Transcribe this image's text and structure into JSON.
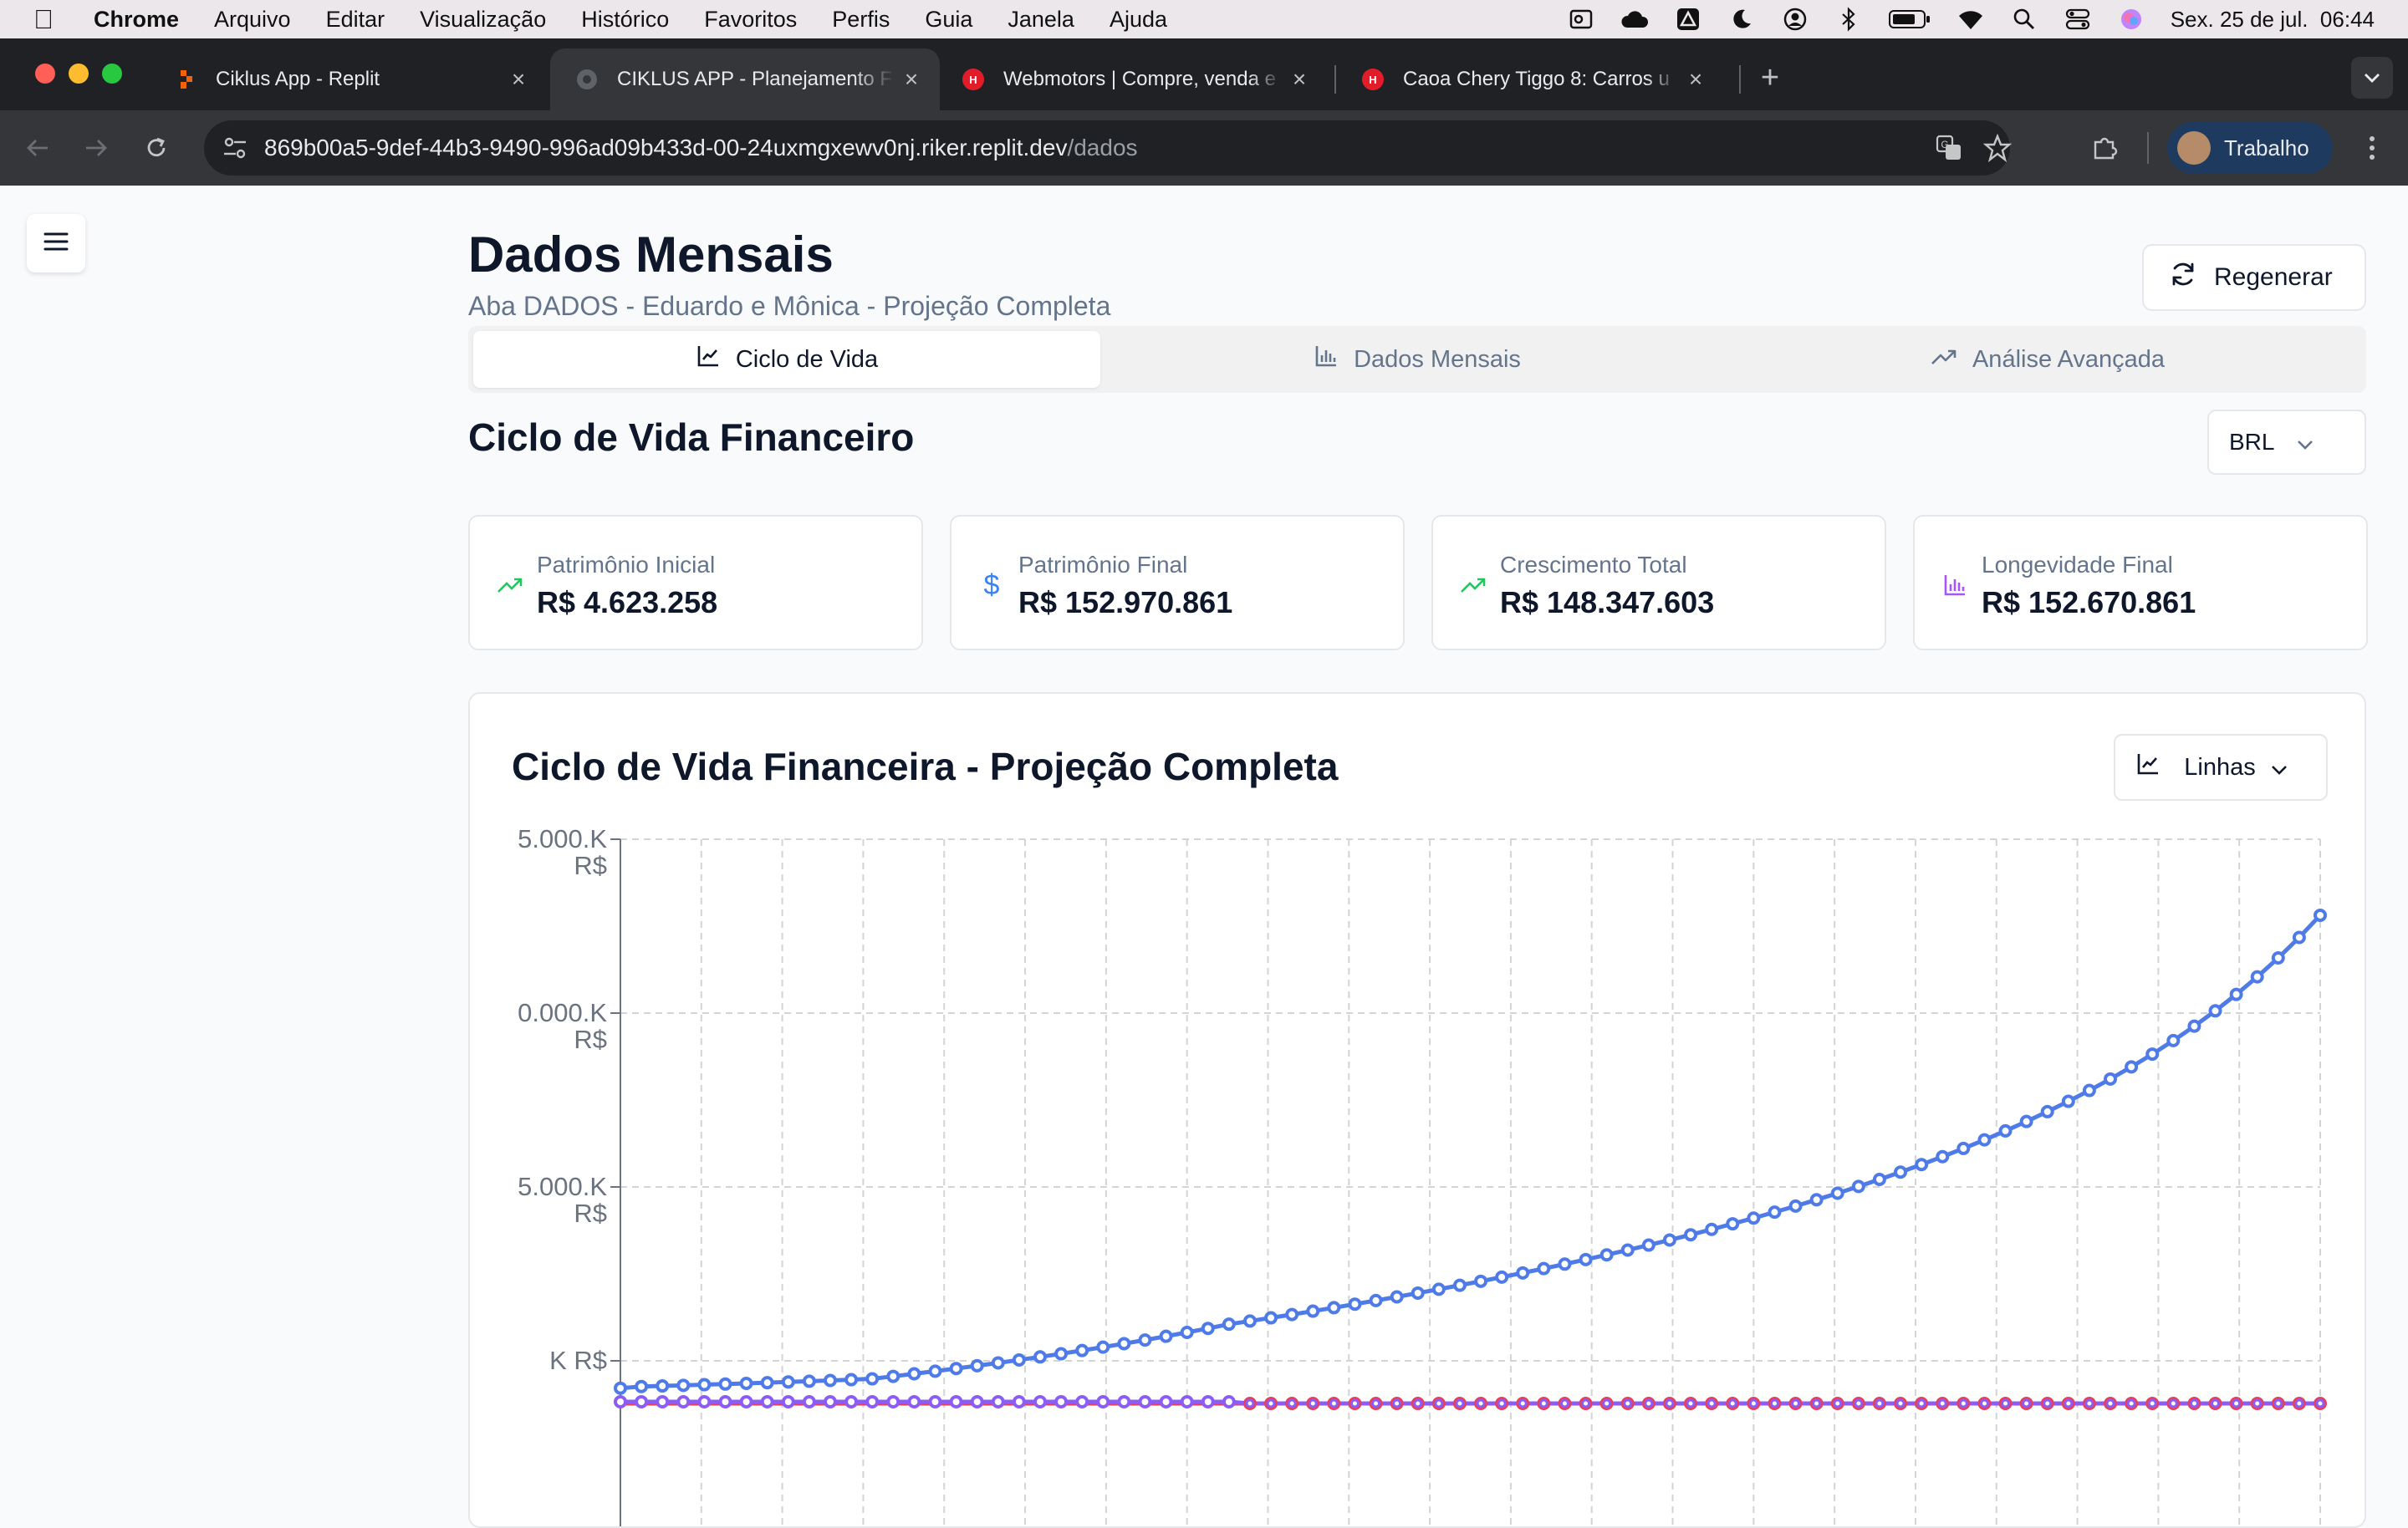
{
  "menubar": {
    "app": "Chrome",
    "items": [
      "Arquivo",
      "Editar",
      "Visualização",
      "Histórico",
      "Favoritos",
      "Perfis",
      "Guia",
      "Janela",
      "Ajuda"
    ],
    "clock": "Sex. 25 de jul.  06:44"
  },
  "browser": {
    "tabs": [
      {
        "title": "Ciklus App - Replit",
        "favicon_color": "#f26207"
      },
      {
        "title": "CIKLUS APP - Planejamento F",
        "favicon_color": "#5f6368"
      },
      {
        "title": "Webmotors | Compre, venda e",
        "favicon_color": "#e11d2a"
      },
      {
        "title": "Caoa Chery Tiggo 8: Carros u",
        "favicon_color": "#e11d2a"
      }
    ],
    "active_tab": 1,
    "url_host": "869b00a5-9def-44b3-9490-996ad09b433d-00-24uxmgxewv0nj.riker.replit.dev",
    "url_path": "/dados",
    "profile": "Trabalho"
  },
  "page": {
    "title": "Dados Mensais",
    "subtitle": "Aba DADOS - Eduardo e Mônica - Projeção Completa",
    "regen_label": "Regenerar",
    "tabs": [
      {
        "label": "Ciclo de Vida",
        "icon": "line-chart-icon"
      },
      {
        "label": "Dados Mensais",
        "icon": "bar-chart-icon"
      },
      {
        "label": "Análise Avançada",
        "icon": "trending-up-icon"
      }
    ],
    "section_title": "Ciclo de Vida Financeiro",
    "currency": "BRL",
    "cards": [
      {
        "label": "Patrimônio Inicial",
        "value": "R$ 4.623.258",
        "icon": "trending-up-icon",
        "color": "#22c55e"
      },
      {
        "label": "Patrimônio Final",
        "value": "R$ 152.970.861",
        "icon": "dollar-icon",
        "color": "#3b82f6"
      },
      {
        "label": "Crescimento Total",
        "value": "R$ 148.347.603",
        "icon": "trending-up-icon",
        "color": "#22c55e"
      },
      {
        "label": "Longevidade Final",
        "value": "R$ 152.670.861",
        "icon": "bar-chart-icon",
        "color": "#a855f7"
      }
    ],
    "chart_title": "Ciclo de Vida Financeira - Projeção Completa",
    "chart_type_label": "Linhas"
  },
  "chart_data": {
    "type": "line",
    "title": "Ciclo de Vida Financeira - Projeção Completa",
    "y_tick_labels": [
      "5.000.K R$",
      "0.000.K R$",
      "5.000.K R$",
      "K R$"
    ],
    "ylim": [
      0,
      150000
    ],
    "grid": true,
    "points": 82,
    "series": [
      {
        "color": "#4f7be8",
        "values_k": [
          4623,
          5107,
          5290,
          5476,
          5667,
          5863,
          6065,
          6273,
          6488,
          6711,
          6943,
          7185,
          7440,
          8190,
          8957,
          9745,
          10556,
          11392,
          12254,
          13144,
          14063,
          15013,
          15996,
          17013,
          18066,
          19157,
          20288,
          21461,
          22679,
          23943,
          24895,
          25870,
          26868,
          27889,
          28932,
          29999,
          31089,
          32203,
          33342,
          34506,
          35697,
          36916,
          38163,
          39441,
          40751,
          42095,
          43474,
          44889,
          46343,
          47838,
          49377,
          50960,
          52591,
          54271,
          56002,
          57789,
          59634,
          61542,
          63516,
          65561,
          67682,
          69884,
          72173,
          74556,
          77040,
          79633,
          82344,
          85181,
          88155,
          91278,
          94562,
          98022,
          101673,
          105534,
          109627,
          113976,
          118611,
          123565,
          128879,
          134598,
          140779,
          147489
        ]
      },
      {
        "color": "#e8405a",
        "values_k": "≈0 (flat near baseline)"
      },
      {
        "color": "#8b5cf6",
        "values_k": "≈0 (flat near baseline)"
      }
    ]
  }
}
